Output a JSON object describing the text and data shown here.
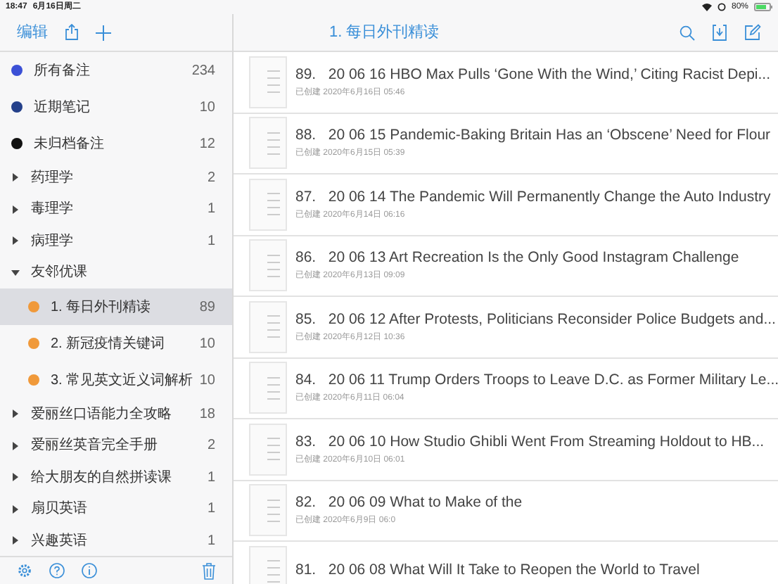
{
  "status_bar": {
    "time": "18:47",
    "date": "6月16日周二",
    "battery": "80%"
  },
  "sidebar": {
    "edit": "编辑",
    "items": [
      {
        "kind": "dot",
        "label": "所有备注",
        "count": "234",
        "color": "#3b50d6",
        "selected": false
      },
      {
        "kind": "dot",
        "label": "近期笔记",
        "count": "10",
        "color": "#24408a",
        "selected": false
      },
      {
        "kind": "dot",
        "label": "未归档备注",
        "count": "12",
        "color": "#111111",
        "selected": false
      },
      {
        "kind": "folder",
        "label": "药理学",
        "count": "2",
        "expanded": false
      },
      {
        "kind": "folder",
        "label": "毒理学",
        "count": "1",
        "expanded": false
      },
      {
        "kind": "folder",
        "label": "病理学",
        "count": "1",
        "expanded": false
      },
      {
        "kind": "folder",
        "label": "友邻优课",
        "expanded": true,
        "children": [
          {
            "kind": "dot",
            "label": "1. 每日外刊精读",
            "count": "89",
            "color": "#f0993a",
            "selected": true
          },
          {
            "kind": "dot",
            "label": "2. 新冠疫情关键词",
            "count": "10",
            "color": "#f0993a",
            "selected": false
          },
          {
            "kind": "dot",
            "label": "3. 常见英文近义词解析",
            "count": "10",
            "color": "#f0993a",
            "selected": false
          }
        ]
      },
      {
        "kind": "folder",
        "label": "爱丽丝口语能力全攻略",
        "count": "18",
        "expanded": false
      },
      {
        "kind": "folder",
        "label": "爱丽丝英音完全手册",
        "count": "2",
        "expanded": false
      },
      {
        "kind": "folder",
        "label": "给大朋友的自然拼读课",
        "count": "1",
        "expanded": false
      },
      {
        "kind": "folder",
        "label": "扇贝英语",
        "count": "1",
        "expanded": false
      },
      {
        "kind": "folder",
        "label": "兴趣英语",
        "count": "1",
        "expanded": false
      }
    ]
  },
  "list": {
    "title": "1. 每日外刊精读",
    "notes": [
      {
        "title": "89.   20 06 16 HBO Max Pulls ‘Gone With the Wind,’ Citing Racist Depi...",
        "created": "已创建 2020年6月16日 05:46"
      },
      {
        "title": "88.   20 06 15 Pandemic-Baking Britain Has an ‘Obscene’ Need for Flour",
        "created": "已创建 2020年6月15日 05:39"
      },
      {
        "title": "87.   20 06 14 The Pandemic Will Permanently Change the Auto Industry",
        "created": "已创建 2020年6月14日 06:16"
      },
      {
        "title": "86.   20 06 13 Art Recreation Is the Only Good Instagram Challenge",
        "created": "已创建 2020年6月13日 09:09"
      },
      {
        "title": "85.   20 06 12 After Protests, Politicians Reconsider Police Budgets and...",
        "created": "已创建 2020年6月12日 10:36"
      },
      {
        "title": "84.   20 06 11 Trump Orders Troops to Leave D.C. as Former Military Le...",
        "created": "已创建 2020年6月11日 06:04"
      },
      {
        "title": "83.   20 06 10 How Studio Ghibli Went From Streaming Holdout to HB...",
        "created": "已创建 2020年6月10日 06:01"
      },
      {
        "title": "82.   20 06 09 What to Make of the",
        "created": "已创建 2020年6月9日 06:0"
      },
      {
        "title": "81.   20 06 08 What Will It Take to Reopen the World to Travel"
      }
    ]
  }
}
